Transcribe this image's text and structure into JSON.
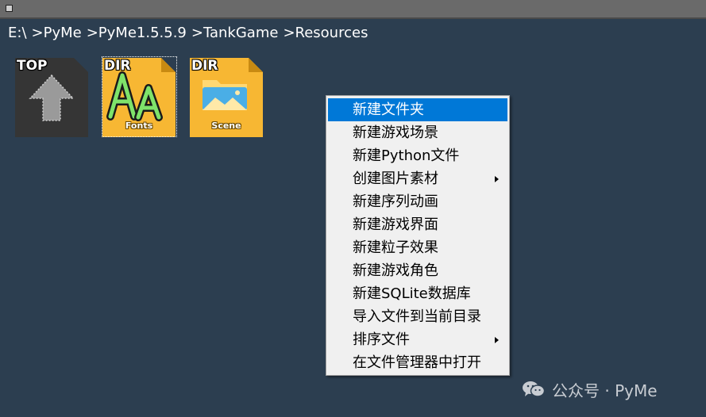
{
  "breadcrumb": [
    "E:\\",
    ">PyMe",
    ">PyMe1.5.5.9",
    ">TankGame",
    ">Resources"
  ],
  "tiles": [
    {
      "tag": "TOP",
      "name": ""
    },
    {
      "tag": "DIR",
      "name": "Fonts"
    },
    {
      "tag": "DIR",
      "name": "Scene"
    }
  ],
  "context_menu": {
    "items": [
      {
        "label": "新建文件夹"
      },
      {
        "label": "新建游戏场景"
      },
      {
        "label": "新建Python文件"
      },
      {
        "label": "创建图片素材"
      },
      {
        "label": "新建序列动画"
      },
      {
        "label": "新建游戏界面"
      },
      {
        "label": "新建粒子效果"
      },
      {
        "label": "新建游戏角色"
      },
      {
        "label": "新建SQLite数据库"
      },
      {
        "label": "导入文件到当前目录"
      },
      {
        "label": "排序文件"
      },
      {
        "label": "在文件管理器中打开"
      }
    ],
    "highlighted_index": 0,
    "submenu_indices": [
      3,
      10
    ]
  },
  "watermark": {
    "text": "公众号 · PyMe",
    "icon": "wechat-icon"
  },
  "colors": {
    "background": "#2c3e50",
    "folder": "#f7b733",
    "highlight": "#0078d7",
    "menu_bg": "#f0f0f0"
  }
}
